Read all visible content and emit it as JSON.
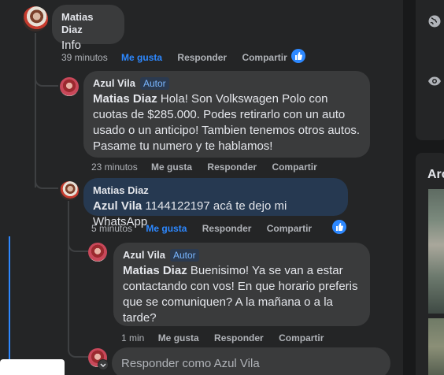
{
  "comments": [
    {
      "author": "Matias Diaz",
      "text": "Info",
      "time": "39 minutos",
      "like": "Me gusta",
      "reply": "Responder",
      "share": "Compartir"
    },
    {
      "author": "Azul Vila",
      "badge": "Autor",
      "mention": "Matias Diaz",
      "text": "Hola! Son Volkswagen Polo con cuotas de $285.000. Podes retirarlo con un auto usado o un anticipo! Tambien tenemos otros autos. Pasame tu numero y te hablamos!",
      "time": "23 minutos",
      "like": "Me gusta",
      "reply": "Responder",
      "share": "Compartir"
    },
    {
      "author": "Matias Diaz",
      "mention": "Azul Vila",
      "text": "1144122197 acá te dejo mi WhatsApp",
      "time": "5 minutos",
      "like": "Me gusta",
      "reply": "Responder",
      "share": "Compartir"
    },
    {
      "author": "Azul Vila",
      "badge": "Autor",
      "mention": "Matias Diaz",
      "text": "Buenisimo! Ya se van a estar contactando con vos! En que horario preferis que se comuniquen? A la mañana o a la tarde?",
      "time": "1 min",
      "like": "Me gusta",
      "reply": "Responder",
      "share": "Compartir"
    }
  ],
  "reply_input": {
    "placeholder": "Responder como Azul Vila"
  },
  "right_panel": {
    "section_title": "Arc"
  },
  "colors": {
    "accent": "#2d88ff",
    "bubble": "#3a3b3c",
    "highlight_bubble": "#263951"
  }
}
